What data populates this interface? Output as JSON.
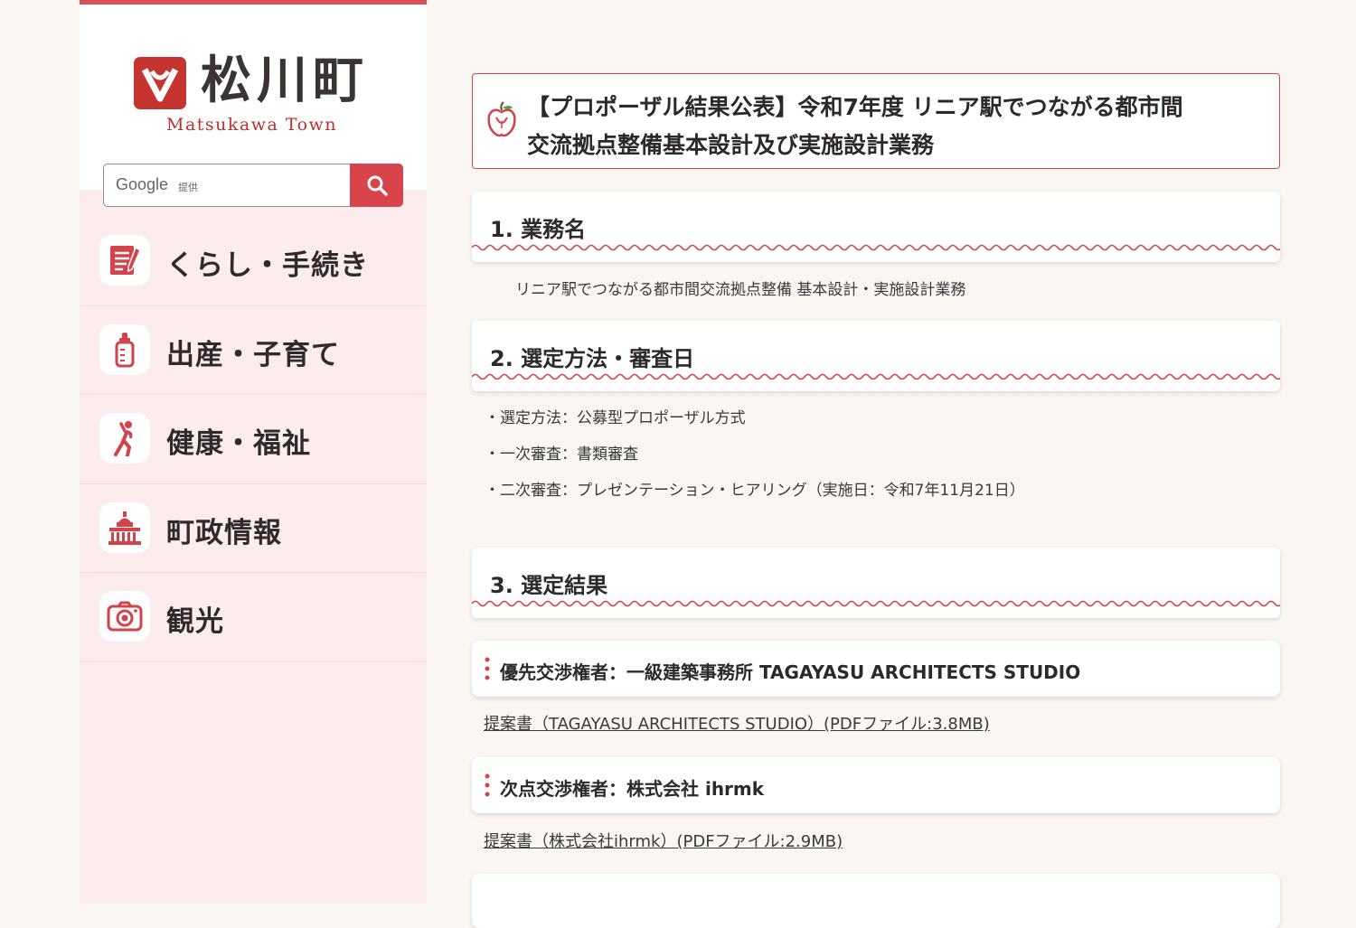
{
  "site": {
    "logo_kanji": "松川町",
    "logo_roman": "Matsukawa Town",
    "accent_color": "#d44f57"
  },
  "search": {
    "brand": "Google",
    "provided_by": "提供",
    "button_icon": "search-icon"
  },
  "nav": {
    "items": [
      {
        "label": "くらし・手続き",
        "icon": "document-pen-icon"
      },
      {
        "label": "出産・子育て",
        "icon": "baby-bottle-icon"
      },
      {
        "label": "健康・福祉",
        "icon": "stretching-person-icon"
      },
      {
        "label": "町政情報",
        "icon": "government-building-icon"
      },
      {
        "label": "観光",
        "icon": "camera-icon"
      }
    ]
  },
  "page": {
    "title_line1": "【プロポーザル結果公表】令和7年度 リニア駅でつながる都市間",
    "title_line2": "交流拠点整備基本設計及び実施設計業務",
    "sections": [
      {
        "heading": "1. 業務名"
      },
      {
        "heading": "2. 選定方法・審査日"
      },
      {
        "heading": "3. 選定結果"
      }
    ],
    "task_name": "リニア駅でつながる都市間交流拠点整備 基本設計・実施設計業務",
    "selection": [
      "・選定方法：公募型プロポーザル方式",
      "・一次審査：書類審査",
      "・二次審査：プレゼンテーション・ヒアリング（実施日：令和7年11月21日）"
    ],
    "results": [
      {
        "heading": "優先交渉権者：一級建築事務所 TAGAYASU ARCHITECTS STUDIO",
        "link": "提案書（TAGAYASU ARCHITECTS STUDIO）(PDFファイル:3.8MB)"
      },
      {
        "heading": "次点交渉権者：株式会社 ihrmk",
        "link": "提案書（株式会社ihrmk）(PDFファイル:2.9MB)"
      }
    ]
  }
}
